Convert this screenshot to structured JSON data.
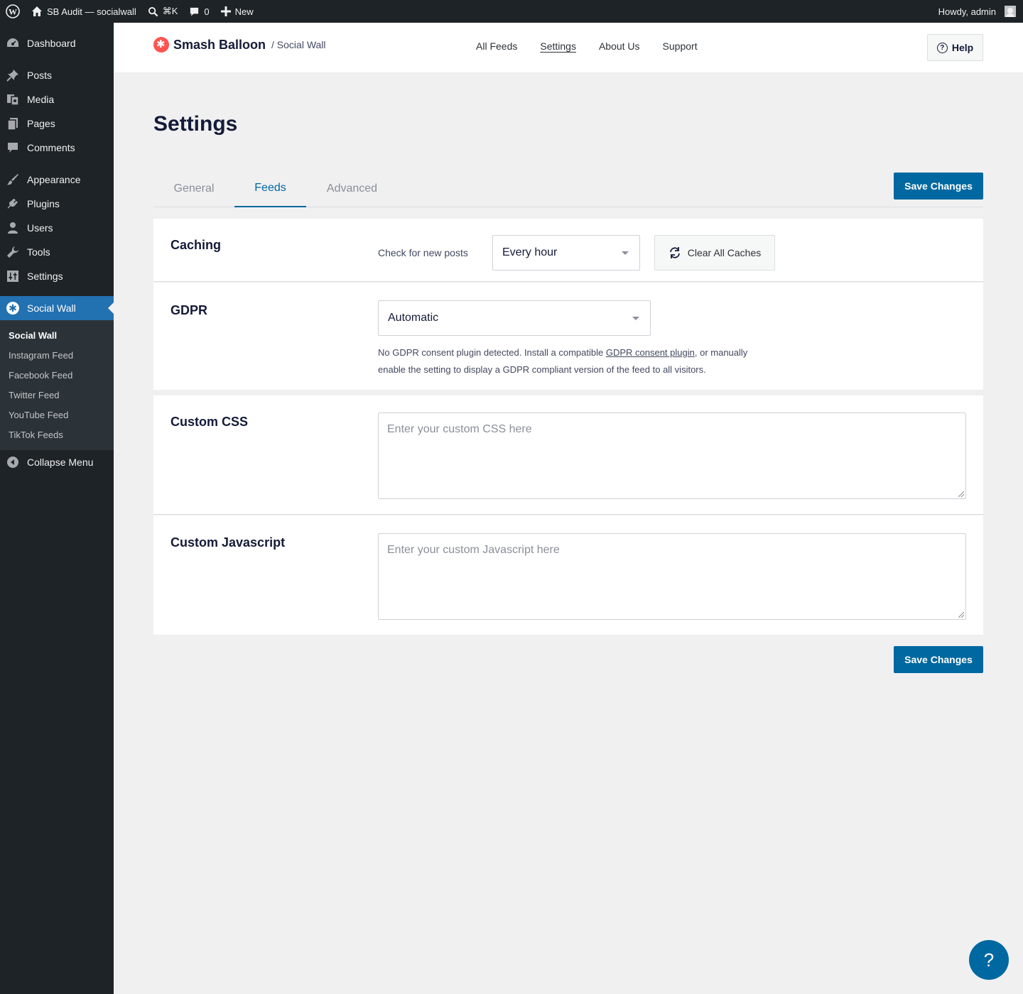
{
  "adminbar": {
    "site_name": "SB Audit — socialwall",
    "search_shortcut": "⌘K",
    "comments_count": "0",
    "new_label": "New",
    "howdy": "Howdy, admin"
  },
  "sidebar": {
    "items": [
      {
        "label": "Dashboard",
        "icon": "dashboard-icon"
      },
      {
        "label": "Posts",
        "icon": "pin-icon"
      },
      {
        "label": "Media",
        "icon": "media-icon"
      },
      {
        "label": "Pages",
        "icon": "pages-icon"
      },
      {
        "label": "Comments",
        "icon": "comment-icon"
      },
      {
        "label": "Appearance",
        "icon": "brush-icon"
      },
      {
        "label": "Plugins",
        "icon": "plugin-icon"
      },
      {
        "label": "Users",
        "icon": "user-icon"
      },
      {
        "label": "Tools",
        "icon": "wrench-icon"
      },
      {
        "label": "Settings",
        "icon": "sliders-icon"
      },
      {
        "label": "Social Wall",
        "icon": "smash-balloon-icon"
      }
    ],
    "submenu": [
      "Social Wall",
      "Instagram Feed",
      "Facebook Feed",
      "Twitter Feed",
      "YouTube Feed",
      "TikTok Feeds"
    ],
    "collapse_label": "Collapse Menu"
  },
  "header": {
    "brand": "Smash Balloon",
    "brand_sub": "/ Social Wall",
    "nav": [
      "All Feeds",
      "Settings",
      "About Us",
      "Support"
    ],
    "help_label": "Help"
  },
  "page": {
    "title": "Settings",
    "tabs": [
      "General",
      "Feeds",
      "Advanced"
    ],
    "save_label": "Save Changes"
  },
  "caching": {
    "title": "Caching",
    "label": "Check for new posts",
    "value": "Every hour",
    "clear_label": "Clear All Caches"
  },
  "gdpr": {
    "title": "GDPR",
    "value": "Automatic",
    "note_before": "No GDPR consent plugin detected. Install a compatible ",
    "note_link": "GDPR consent plugin",
    "note_after": ", or manually enable the setting to display a GDPR compliant version of the feed to all visitors."
  },
  "custom_css": {
    "title": "Custom CSS",
    "placeholder": "Enter your custom CSS here"
  },
  "custom_js": {
    "title": "Custom Javascript",
    "placeholder": "Enter your custom Javascript here"
  },
  "fab_label": "?",
  "colors": {
    "primary": "#0068a0",
    "admin_bg": "#1d2327",
    "admin_accent": "#2271b1",
    "brand_red": "#fe544f"
  }
}
